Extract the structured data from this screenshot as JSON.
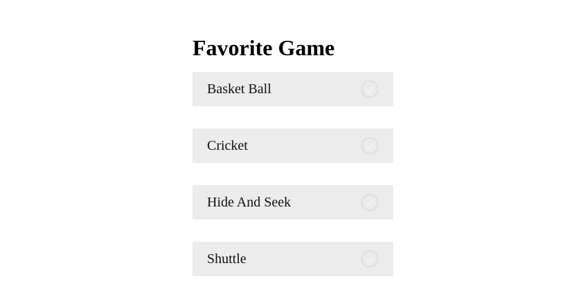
{
  "title": "Favorite Game",
  "options": [
    {
      "label": "Basket Ball",
      "icon": "check-circle-icon",
      "selected": false
    },
    {
      "label": "Cricket",
      "icon": "check-circle-icon",
      "selected": false
    },
    {
      "label": "Hide And Seek",
      "icon": "check-circle-icon",
      "selected": false
    },
    {
      "label": "Shuttle",
      "icon": "check-circle-icon",
      "selected": false
    }
  ],
  "colors": {
    "option_background": "#ececec",
    "check_icon_stroke": "#dedede",
    "title_text": "#000000"
  }
}
